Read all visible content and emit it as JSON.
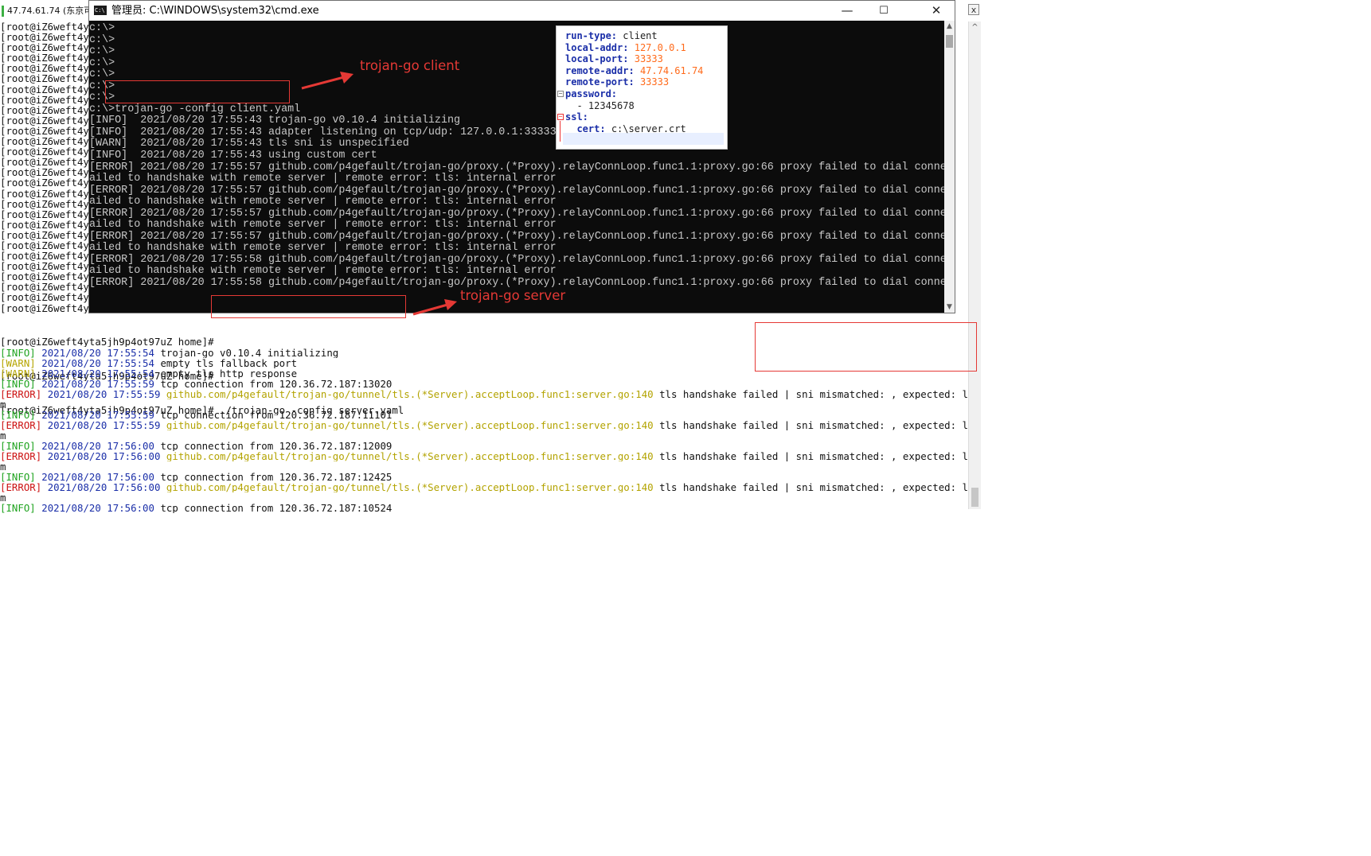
{
  "ssh_window": {
    "title": "47.74.61.74 (东京可",
    "prompt_prefix": "[root@iZ6weft4y",
    "prompt_rows": 28,
    "close_glyph": "x",
    "tail_lines": [
      "[root@iZ6weft4yta5jh9p4ot97uZ home]#",
      "[root@iZ6weft4yta5jh9p4ot97uZ home]#",
      "[root@iZ6weft4yta5jh9p4ot97uZ home]# ./trojan-go -config server.yaml"
    ],
    "server_log": [
      {
        "level": "[INFO]",
        "type": "info",
        "ts": "2021/08/20 17:55:54",
        "pkg": "",
        "msg": "trojan-go v0.10.4 initializing"
      },
      {
        "level": "[WARN]",
        "type": "warn",
        "ts": "2021/08/20 17:55:54",
        "pkg": "",
        "msg": "empty tls fallback port"
      },
      {
        "level": "[WARN]",
        "type": "warn",
        "ts": "2021/08/20 17:55:54",
        "pkg": "",
        "msg": "empty tls http response"
      },
      {
        "level": "[INFO]",
        "type": "info",
        "ts": "2021/08/20 17:55:59",
        "pkg": "",
        "msg": "tcp connection from 120.36.72.187:13020"
      },
      {
        "level": "[ERROR]",
        "type": "error",
        "ts": "2021/08/20 17:55:59",
        "pkg": "github.com/p4gefault/trojan-go/tunnel/tls.(*Server).acceptLoop.func1:server.go:140",
        "msg": "tls handshake failed | sni mismatched: , expected: lab.c"
      },
      {
        "level": "m",
        "type": "plain",
        "ts": "",
        "pkg": "",
        "msg": ""
      },
      {
        "level": "[INFO]",
        "type": "info",
        "ts": "2021/08/20 17:55:59",
        "pkg": "",
        "msg": "tcp connection from 120.36.72.187:11101"
      },
      {
        "level": "[ERROR]",
        "type": "error",
        "ts": "2021/08/20 17:55:59",
        "pkg": "github.com/p4gefault/trojan-go/tunnel/tls.(*Server).acceptLoop.func1:server.go:140",
        "msg": "tls handshake failed | sni mismatched: , expected: lab.c"
      },
      {
        "level": "m",
        "type": "plain",
        "ts": "",
        "pkg": "",
        "msg": ""
      },
      {
        "level": "[INFO]",
        "type": "info",
        "ts": "2021/08/20 17:56:00",
        "pkg": "",
        "msg": "tcp connection from 120.36.72.187:12009"
      },
      {
        "level": "[ERROR]",
        "type": "error",
        "ts": "2021/08/20 17:56:00",
        "pkg": "github.com/p4gefault/trojan-go/tunnel/tls.(*Server).acceptLoop.func1:server.go:140",
        "msg": "tls handshake failed | sni mismatched: , expected: lab.c"
      },
      {
        "level": "m",
        "type": "plain",
        "ts": "",
        "pkg": "",
        "msg": ""
      },
      {
        "level": "[INFO]",
        "type": "info",
        "ts": "2021/08/20 17:56:00",
        "pkg": "",
        "msg": "tcp connection from 120.36.72.187:12425"
      },
      {
        "level": "[ERROR]",
        "type": "error",
        "ts": "2021/08/20 17:56:00",
        "pkg": "github.com/p4gefault/trojan-go/tunnel/tls.(*Server).acceptLoop.func1:server.go:140",
        "msg": "tls handshake failed | sni mismatched: , expected: lab.c"
      },
      {
        "level": "m",
        "type": "plain",
        "ts": "",
        "pkg": "",
        "msg": ""
      },
      {
        "level": "[INFO]",
        "type": "info",
        "ts": "2021/08/20 17:56:00",
        "pkg": "",
        "msg": "tcp connection from 120.36.72.187:10524"
      }
    ]
  },
  "cmd_window": {
    "icon_text": "C:\\",
    "title": "管理员: C:\\WINDOWS\\system32\\cmd.exe",
    "minimize_glyph": "—",
    "maximize_glyph": "☐",
    "close_glyph": "✕",
    "scroll_up": "▲",
    "scroll_down": "▼",
    "lines": [
      "c:\\>",
      "c:\\>",
      "c:\\>",
      "c:\\>",
      "c:\\>",
      "c:\\>",
      "c:\\>",
      "c:\\>trojan-go -config client.yaml",
      "[INFO]  2021/08/20 17:55:43 trojan-go v0.10.4 initializing",
      "[INFO]  2021/08/20 17:55:43 adapter listening on tcp/udp: 127.0.0.1:33333",
      "[WARN]  2021/08/20 17:55:43 tls sni is unspecified",
      "[INFO]  2021/08/20 17:55:43 using custom cert",
      "[ERROR] 2021/08/20 17:55:57 github.com/p4gefault/trojan-go/proxy.(*Proxy).relayConnLoop.func1.1:proxy.go:66 proxy failed to dial connection | tls f",
      "ailed to handshake with remote server | remote error: tls: internal error",
      "[ERROR] 2021/08/20 17:55:57 github.com/p4gefault/trojan-go/proxy.(*Proxy).relayConnLoop.func1.1:proxy.go:66 proxy failed to dial connection | tls f",
      "ailed to handshake with remote server | remote error: tls: internal error",
      "[ERROR] 2021/08/20 17:55:57 github.com/p4gefault/trojan-go/proxy.(*Proxy).relayConnLoop.func1.1:proxy.go:66 proxy failed to dial connection | tls f",
      "ailed to handshake with remote server | remote error: tls: internal error",
      "[ERROR] 2021/08/20 17:55:57 github.com/p4gefault/trojan-go/proxy.(*Proxy).relayConnLoop.func1.1:proxy.go:66 proxy failed to dial connection | tls f",
      "ailed to handshake with remote server | remote error: tls: internal error",
      "[ERROR] 2021/08/20 17:55:58 github.com/p4gefault/trojan-go/proxy.(*Proxy).relayConnLoop.func1.1:proxy.go:66 proxy failed to dial connection | tls f",
      "ailed to handshake with remote server | remote error: tls: internal error",
      "[ERROR] 2021/08/20 17:55:58 github.com/p4gefault/trojan-go/proxy.(*Proxy).relayConnLoop.func1.1:proxy.go:66 proxy failed to dial connection | tls f"
    ]
  },
  "yaml_panel": {
    "lines": [
      {
        "key": "run-type:",
        "value": "client",
        "vtype": "plain"
      },
      {
        "key": "local-addr:",
        "value": "127.0.0.1",
        "vtype": "value"
      },
      {
        "key": "local-port:",
        "value": "33333",
        "vtype": "value"
      },
      {
        "key": "remote-addr:",
        "value": "47.74.61.74",
        "vtype": "value"
      },
      {
        "key": "remote-port:",
        "value": "33333",
        "vtype": "value"
      },
      {
        "key": "password:",
        "value": "",
        "vtype": "plain"
      },
      {
        "key": "",
        "value": "  - 12345678",
        "vtype": "plain"
      },
      {
        "key": "ssl:",
        "value": "",
        "vtype": "plain"
      },
      {
        "key": "  cert:",
        "value": "c:\\server.crt",
        "vtype": "plain"
      }
    ],
    "fold_glyph": "−"
  },
  "annotations": {
    "client_label": "trojan-go client",
    "server_label": "trojan-go server",
    "color": "#e53935"
  }
}
